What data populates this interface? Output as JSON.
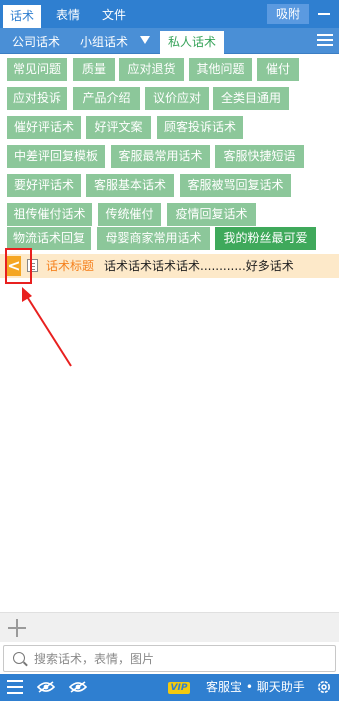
{
  "top_tabs": [
    "话术",
    "表情",
    "文件"
  ],
  "pin_label": "吸附",
  "sub_tabs": [
    "公司话术",
    "小组话术",
    "私人话术"
  ],
  "tags": [
    "常见问题",
    "质量",
    "应对退货",
    "其他问题",
    "催付",
    "应对投诉",
    "产品介绍",
    "议价应对",
    "全类目通用",
    "催好评话术",
    "好评文案",
    "顾客投诉话术",
    "中差评回复模板",
    "客服最常用话术",
    "客服快捷短语",
    "要好评话术",
    "客服基本话术",
    "客服被骂回复话术",
    "祖传催付话术",
    "传统催付",
    "疫情回复话术",
    "物流话术回复",
    "母婴商家常用话术",
    "我的粉丝最可爱"
  ],
  "item": {
    "back_label": "<",
    "title": "话术标题",
    "content": "话术话术话术话术............好多话术"
  },
  "search": {
    "placeholder": "搜索话术，表情，图片"
  },
  "footer": {
    "vip_label": "VIP",
    "brand": "客服宝 • 聊天助手"
  },
  "colors": {
    "primary": "#2f7fd0",
    "tag": "#8cc79a",
    "tag_active": "#3fa95b",
    "highlight": "#e8201f",
    "title": "#f58220"
  }
}
